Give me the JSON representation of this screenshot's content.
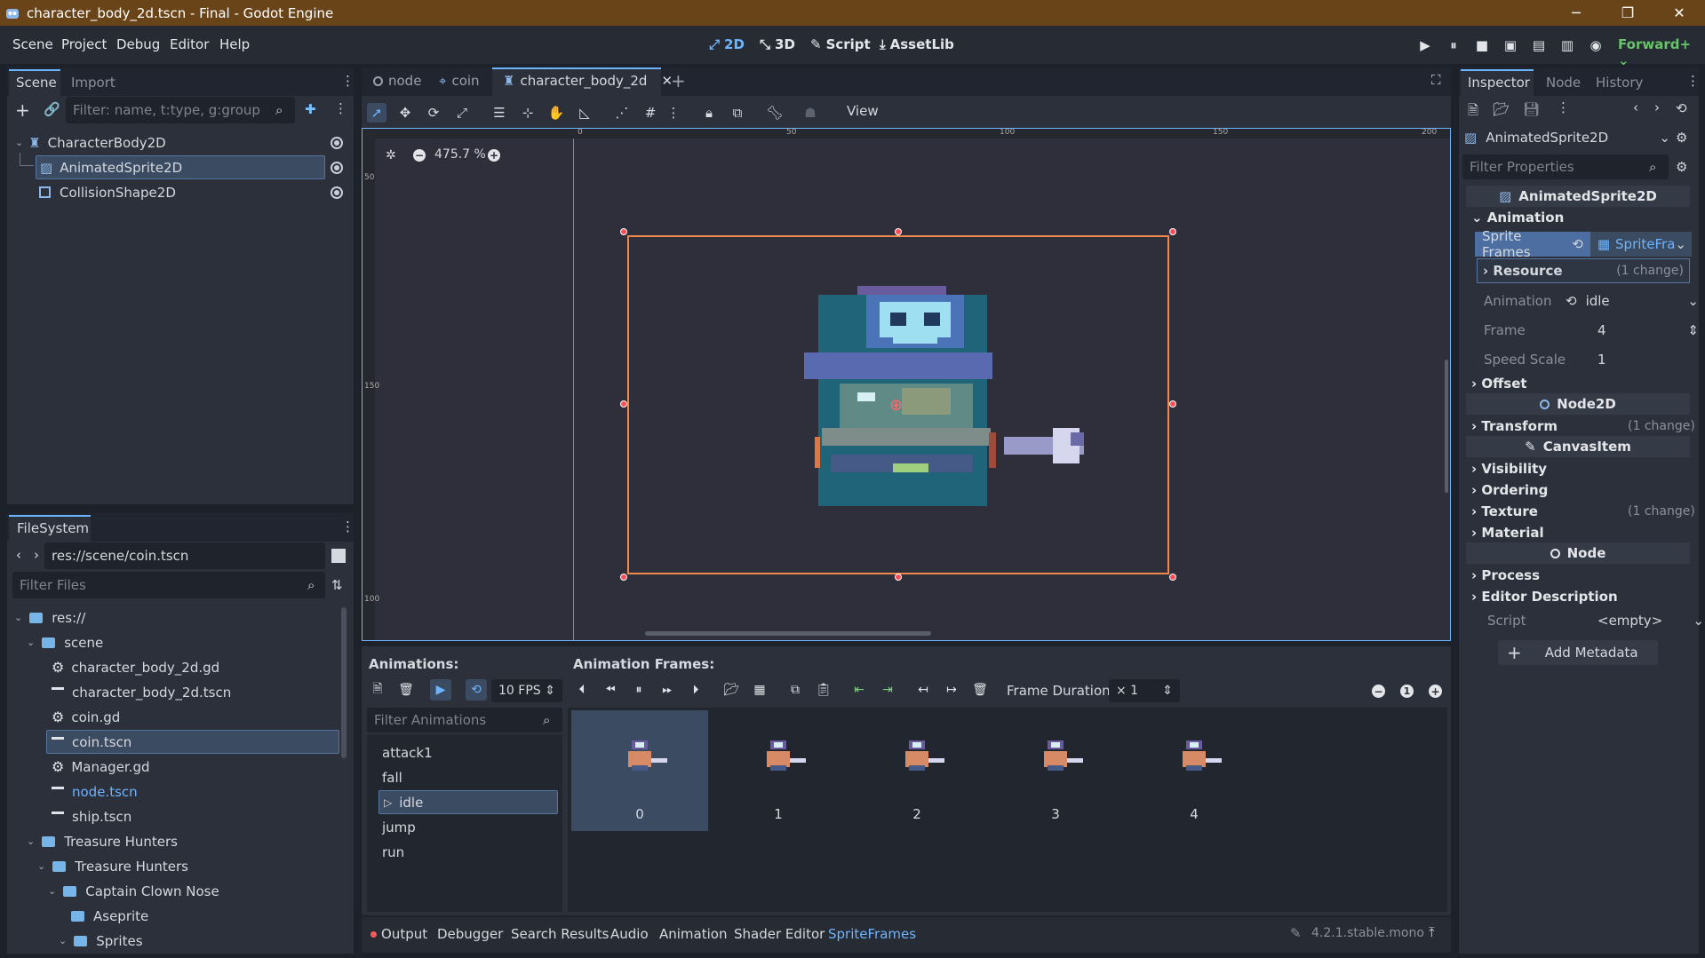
{
  "window": {
    "title": "character_body_2d.tscn - Final - Godot Engine",
    "minimize": "─",
    "maximize": "❐",
    "close": "✕"
  },
  "menu": [
    "Scene",
    "Project",
    "Debug",
    "Editor",
    "Help"
  ],
  "workspaces": [
    {
      "label": "2D",
      "icon": "2d-icon",
      "active": true
    },
    {
      "label": "3D",
      "icon": "3d-icon",
      "active": false
    },
    {
      "label": "Script",
      "icon": "script-icon",
      "active": false
    },
    {
      "label": "AssetLib",
      "icon": "assetlib-icon",
      "active": false
    }
  ],
  "renderer": "Forward+",
  "scene_dock": {
    "tabs": [
      "Scene",
      "Import"
    ],
    "filter_placeholder": "Filter: name, t:type, g:group",
    "nodes": [
      "CharacterBody2D",
      "AnimatedSprite2D",
      "CollisionShape2D"
    ]
  },
  "filesystem": {
    "tab": "FileSystem",
    "path": "res://scene/coin.tscn",
    "filter_placeholder": "Filter Files",
    "items": [
      "res://",
      "scene",
      "character_body_2d.gd",
      "character_body_2d.tscn",
      "coin.gd",
      "coin.tscn",
      "Manager.gd",
      "node.tscn",
      "ship.tscn",
      "Treasure Hunters",
      "Treasure Hunters",
      "Captain Clown Nose",
      "Aseprite",
      "Sprites"
    ]
  },
  "editor_tabs": [
    "node",
    "coin",
    "character_body_2d"
  ],
  "viewport": {
    "view_menu": "View",
    "zoom": "475.7 %",
    "ruler_top": [
      "0",
      "50",
      "100",
      "150",
      "200"
    ],
    "ruler_left": [
      "50",
      "150",
      "100"
    ]
  },
  "spriteframes": {
    "animations_label": "Animations:",
    "frames_label": "Animation Frames:",
    "fps": "10 FPS",
    "frame_duration_label": "Frame Duration:",
    "frame_duration": "× 1",
    "filter_placeholder": "Filter Animations",
    "animations": [
      "attack1",
      "fall",
      "idle",
      "jump",
      "run"
    ],
    "selected_animation": "idle",
    "frames": [
      "0",
      "1",
      "2",
      "3",
      "4"
    ]
  },
  "bottom_tabs": [
    "Output",
    "Debugger",
    "Search Results",
    "Audio",
    "Animation",
    "Shader Editor",
    "SpriteFrames"
  ],
  "version": "4.2.1.stable.mono",
  "inspector": {
    "tabs": [
      "Inspector",
      "Node",
      "History"
    ],
    "object": "AnimatedSprite2D",
    "filter_placeholder": "Filter Properties",
    "class_header": "AnimatedSprite2D",
    "animation_category": "Animation",
    "sprite_frames_label": "Sprite Frames",
    "sprite_frames_value": "SpriteFra",
    "resource_label": "Resource",
    "resource_change": "(1 change)",
    "animation_label": "Animation",
    "animation_value": "idle",
    "frame_label": "Frame",
    "frame_value": "4",
    "speed_label": "Speed Scale",
    "speed_value": "1",
    "offset": "Offset",
    "node2d": "Node2D",
    "transform": "Transform",
    "transform_change": "(1 change)",
    "canvasitem": "CanvasItem",
    "visibility": "Visibility",
    "ordering": "Ordering",
    "texture": "Texture",
    "texture_change": "(1 change)",
    "material": "Material",
    "node": "Node",
    "process": "Process",
    "editor_description": "Editor Description",
    "script_label": "Script",
    "script_value": "<empty>",
    "add_metadata": "Add Metadata"
  },
  "colors": {
    "accent": "#6cb4ff",
    "titlebar": "#6a4419",
    "selection": "#3b4b61"
  }
}
